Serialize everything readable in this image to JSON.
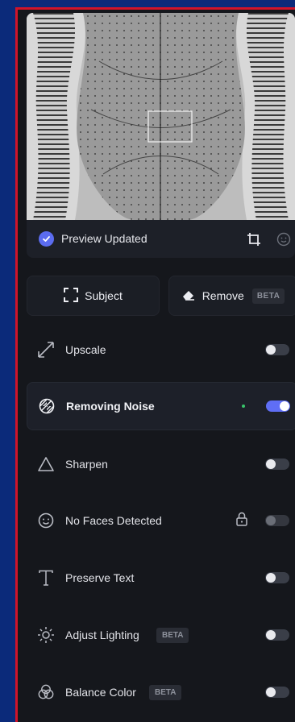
{
  "preview": {
    "status": "Preview Updated"
  },
  "actions": {
    "subject_label": "Subject",
    "remove_label": "Remove",
    "remove_badge": "BETA"
  },
  "options": [
    {
      "label": "Upscale",
      "icon": "upscale-arrow-icon",
      "state": "off"
    },
    {
      "label": "Removing Noise",
      "icon": "noise-icon",
      "state": "on",
      "active": true
    },
    {
      "label": "Sharpen",
      "icon": "triangle-icon",
      "state": "off"
    },
    {
      "label": "No Faces Detected",
      "icon": "face-icon",
      "state": "disabled",
      "locked": true
    },
    {
      "label": "Preserve Text",
      "icon": "text-icon",
      "state": "off"
    },
    {
      "label": "Adjust Lighting",
      "icon": "sun-icon",
      "state": "off",
      "badge": "BETA"
    },
    {
      "label": "Balance Color",
      "icon": "color-circles-icon",
      "state": "off",
      "badge": "BETA"
    }
  ],
  "colors": {
    "accent": "#5f6ef5",
    "background": "#15171c",
    "card": "#1d2028",
    "active_dot": "#39c46a",
    "outer": "#0b2a7a",
    "frame_border": "#d0142a"
  }
}
